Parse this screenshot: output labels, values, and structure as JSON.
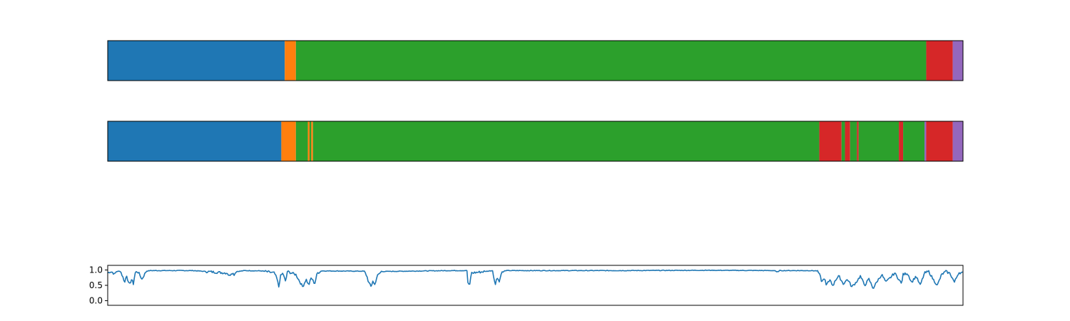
{
  "chart_data": [
    {
      "type": "segments",
      "x_range": [
        0,
        1
      ],
      "ticks_visible": false,
      "segments": [
        {
          "start": 0.0,
          "end": 0.207,
          "label_class": 0
        },
        {
          "start": 0.207,
          "end": 0.22,
          "label_class": 1
        },
        {
          "start": 0.22,
          "end": 0.957,
          "label_class": 2
        },
        {
          "start": 0.957,
          "end": 0.988,
          "label_class": 3
        },
        {
          "start": 0.988,
          "end": 1.0,
          "label_class": 4
        }
      ]
    },
    {
      "type": "segments",
      "x_range": [
        0,
        1
      ],
      "ticks_visible": false,
      "segments": [
        {
          "start": 0.0,
          "end": 0.203,
          "label_class": 0
        },
        {
          "start": 0.203,
          "end": 0.22,
          "label_class": 1
        },
        {
          "start": 0.22,
          "end": 0.234,
          "label_class": 2
        },
        {
          "start": 0.234,
          "end": 0.236,
          "label_class": 1
        },
        {
          "start": 0.236,
          "end": 0.238,
          "label_class": 2
        },
        {
          "start": 0.238,
          "end": 0.24,
          "label_class": 1
        },
        {
          "start": 0.24,
          "end": 0.832,
          "label_class": 2
        },
        {
          "start": 0.832,
          "end": 0.858,
          "label_class": 3
        },
        {
          "start": 0.858,
          "end": 0.862,
          "label_class": 2
        },
        {
          "start": 0.862,
          "end": 0.868,
          "label_class": 3
        },
        {
          "start": 0.868,
          "end": 0.876,
          "label_class": 2
        },
        {
          "start": 0.876,
          "end": 0.878,
          "label_class": 3
        },
        {
          "start": 0.878,
          "end": 0.925,
          "label_class": 2
        },
        {
          "start": 0.925,
          "end": 0.93,
          "label_class": 3
        },
        {
          "start": 0.93,
          "end": 0.955,
          "label_class": 2
        },
        {
          "start": 0.955,
          "end": 0.957,
          "label_class": 4
        },
        {
          "start": 0.957,
          "end": 0.988,
          "label_class": 3
        },
        {
          "start": 0.988,
          "end": 1.0,
          "label_class": 4
        }
      ]
    },
    {
      "type": "line",
      "x_range": [
        0,
        1
      ],
      "ylim": [
        -0.15,
        1.15
      ],
      "yticks": [
        {
          "value": 0.0,
          "label": "0.0"
        },
        {
          "value": 0.5,
          "label": "0.5"
        },
        {
          "value": 1.0,
          "label": "1.0"
        }
      ],
      "x_ticks_visible": false,
      "series": [
        {
          "color": "#1f77b4",
          "base": 0.98,
          "x": [
            0.0,
            0.003,
            0.006,
            0.008,
            0.01,
            0.015,
            0.02,
            0.022,
            0.025,
            0.028,
            0.03,
            0.032,
            0.034,
            0.036,
            0.04,
            0.045,
            0.05,
            0.1,
            0.14,
            0.142,
            0.145,
            0.148,
            0.15,
            0.155,
            0.16,
            0.18,
            0.195,
            0.198,
            0.2,
            0.202,
            0.205,
            0.208,
            0.21,
            0.22,
            0.225,
            0.228,
            0.232,
            0.235,
            0.238,
            0.242,
            0.245,
            0.25,
            0.3,
            0.303,
            0.305,
            0.308,
            0.31,
            0.312,
            0.315,
            0.32,
            0.4,
            0.42,
            0.421,
            0.423,
            0.425,
            0.45,
            0.452,
            0.453,
            0.455,
            0.458,
            0.46,
            0.465,
            0.48,
            0.5,
            0.6,
            0.7,
            0.78,
            0.783,
            0.785,
            0.8,
            0.82,
            0.83,
            0.833,
            0.835,
            0.838,
            0.84,
            0.845,
            0.848,
            0.85,
            0.855,
            0.86,
            0.865,
            0.87,
            0.875,
            0.88,
            0.885,
            0.89,
            0.895,
            0.9,
            0.905,
            0.91,
            0.915,
            0.92,
            0.925,
            0.928,
            0.93,
            0.935,
            0.94,
            0.945,
            0.95,
            0.955,
            0.96,
            0.965,
            0.97,
            0.975,
            0.98,
            0.985,
            0.99,
            0.995,
            1.0
          ],
          "y": [
            0.9,
            0.95,
            0.92,
            0.85,
            0.95,
            0.96,
            0.6,
            0.85,
            0.5,
            0.7,
            0.55,
            0.9,
            0.95,
            0.92,
            0.7,
            0.96,
            0.98,
            0.98,
            0.9,
            0.8,
            0.92,
            0.85,
            0.95,
            0.96,
            0.98,
            0.97,
            0.9,
            0.7,
            0.45,
            0.8,
            0.9,
            0.6,
            0.95,
            0.85,
            0.6,
            0.45,
            0.7,
            0.5,
            0.75,
            0.55,
            0.9,
            0.97,
            0.96,
            0.8,
            0.6,
            0.45,
            0.65,
            0.5,
            0.8,
            0.95,
            0.98,
            0.98,
            0.6,
            0.45,
            0.9,
            0.98,
            0.7,
            0.45,
            0.8,
            0.6,
            0.9,
            0.98,
            0.98,
            0.98,
            0.98,
            0.99,
            0.98,
            0.9,
            0.98,
            0.98,
            0.98,
            0.97,
            0.8,
            0.6,
            0.75,
            0.5,
            0.7,
            0.45,
            0.65,
            0.8,
            0.55,
            0.7,
            0.45,
            0.6,
            0.8,
            0.5,
            0.7,
            0.4,
            0.65,
            0.85,
            0.6,
            0.75,
            0.9,
            0.7,
            0.55,
            0.85,
            0.9,
            0.6,
            0.8,
            0.5,
            0.9,
            0.95,
            0.7,
            0.5,
            0.85,
            0.95,
            0.88,
            0.6,
            0.92,
            0.9
          ]
        }
      ]
    }
  ],
  "colors": {
    "class_0": "#1f77b4",
    "class_1": "#ff7f0e",
    "class_2": "#2ca02c",
    "class_3": "#d62728",
    "class_4": "#9467bd",
    "axis": "#000000",
    "background": "#ffffff"
  }
}
